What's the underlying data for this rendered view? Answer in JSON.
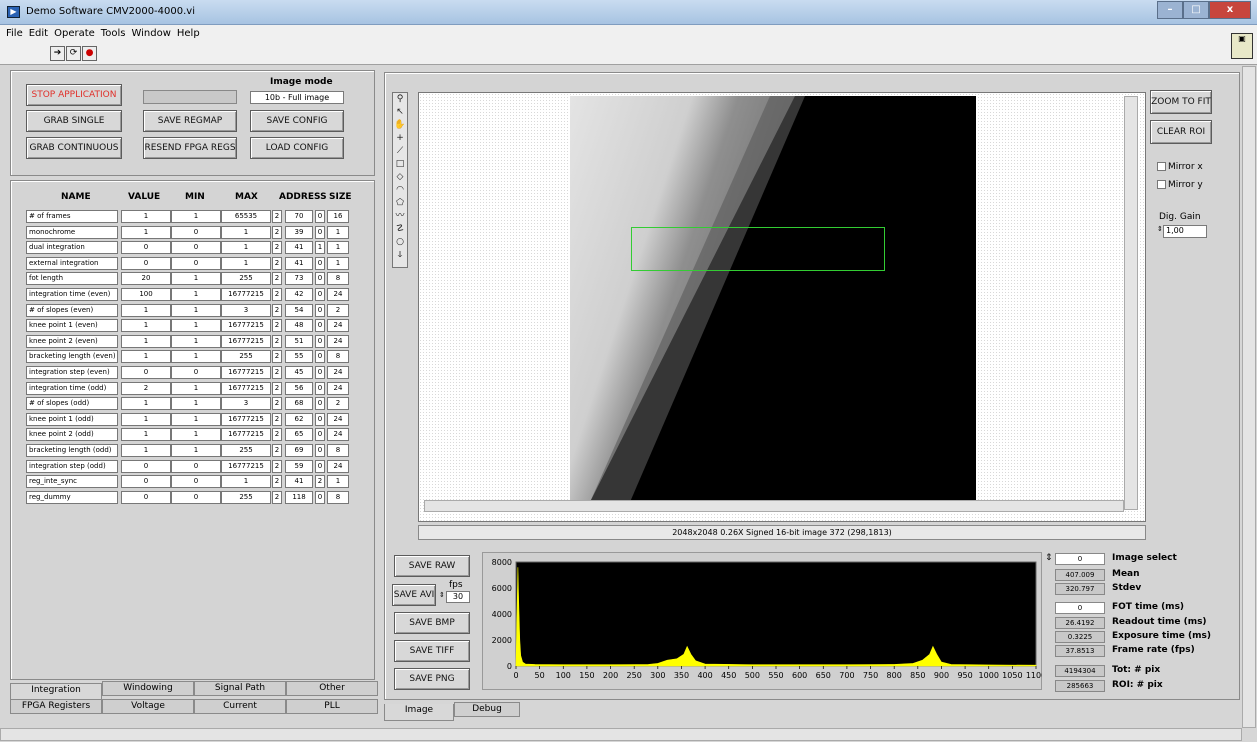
{
  "window": {
    "title": "Demo Software CMV2000-4000.vi",
    "icon": "labview-vi-icon"
  },
  "menu": [
    "File",
    "Edit",
    "Operate",
    "Tools",
    "Window",
    "Help"
  ],
  "controls": {
    "stop": "STOP APPLICATION",
    "grab_single": "GRAB SINGLE",
    "grab_continuous": "GRAB CONTINUOUS",
    "save_regmap": "SAVE REGMAP",
    "resend": "RESEND FPGA REGS",
    "save_config": "SAVE CONFIG",
    "load_config": "LOAD CONFIG",
    "image_mode_label": "Image mode",
    "image_mode_value": "10b - Full image"
  },
  "table": {
    "headers": [
      "NAME",
      "VALUE",
      "MIN",
      "MAX",
      "ADDRESS",
      "SIZE"
    ],
    "rows": [
      [
        "# of frames",
        "1",
        "1",
        "65535",
        "2",
        "70",
        "0",
        "16"
      ],
      [
        "monochrome",
        "1",
        "0",
        "1",
        "2",
        "39",
        "0",
        "1"
      ],
      [
        "dual integration",
        "0",
        "0",
        "1",
        "2",
        "41",
        "1",
        "1"
      ],
      [
        "external integration",
        "0",
        "0",
        "1",
        "2",
        "41",
        "0",
        "1"
      ],
      [
        "fot length",
        "20",
        "1",
        "255",
        "2",
        "73",
        "0",
        "8"
      ],
      [
        "integration time (even)",
        "100",
        "1",
        "16777215",
        "2",
        "42",
        "0",
        "24"
      ],
      [
        "# of slopes (even)",
        "1",
        "1",
        "3",
        "2",
        "54",
        "0",
        "2"
      ],
      [
        "knee point 1 (even)",
        "1",
        "1",
        "16777215",
        "2",
        "48",
        "0",
        "24"
      ],
      [
        "knee point 2 (even)",
        "1",
        "1",
        "16777215",
        "2",
        "51",
        "0",
        "24"
      ],
      [
        "bracketing length (even)",
        "1",
        "1",
        "255",
        "2",
        "55",
        "0",
        "8"
      ],
      [
        "integration step (even)",
        "0",
        "0",
        "16777215",
        "2",
        "45",
        "0",
        "24"
      ],
      [
        "integration time (odd)",
        "2",
        "1",
        "16777215",
        "2",
        "56",
        "0",
        "24"
      ],
      [
        "# of slopes (odd)",
        "1",
        "1",
        "3",
        "2",
        "68",
        "0",
        "2"
      ],
      [
        "knee point 1 (odd)",
        "1",
        "1",
        "16777215",
        "2",
        "62",
        "0",
        "24"
      ],
      [
        "knee point 2 (odd)",
        "1",
        "1",
        "16777215",
        "2",
        "65",
        "0",
        "24"
      ],
      [
        "bracketing length (odd)",
        "1",
        "1",
        "255",
        "2",
        "69",
        "0",
        "8"
      ],
      [
        "integration step (odd)",
        "0",
        "0",
        "16777215",
        "2",
        "59",
        "0",
        "24"
      ],
      [
        "reg_inte_sync",
        "0",
        "0",
        "1",
        "2",
        "41",
        "2",
        "1"
      ],
      [
        "reg_dummy",
        "0",
        "0",
        "255",
        "2",
        "118",
        "0",
        "8"
      ]
    ]
  },
  "left_tabs_top": [
    "Integration",
    "Windowing",
    "Signal Path",
    "Other"
  ],
  "left_tabs_bottom": [
    "FPGA Registers",
    "Voltage",
    "Current",
    "PLL"
  ],
  "image": {
    "status": "2048x2048 0.26X Signed 16-bit image 372    (298,1813)",
    "zoom_to_fit": "ZOOM TO FIT",
    "clear_roi": "CLEAR ROI",
    "mirror_x": "Mirror x",
    "mirror_y": "Mirror y",
    "dig_gain_label": "Dig. Gain",
    "dig_gain_value": "1,00"
  },
  "save": {
    "raw": "SAVE RAW",
    "avi": "SAVE AVI",
    "fps_label": "fps",
    "fps_value": "30",
    "bmp": "SAVE BMP",
    "tiff": "SAVE TIFF",
    "png": "SAVE PNG"
  },
  "bottom_tabs": [
    "Image",
    "Debug"
  ],
  "stats": [
    {
      "value": "0",
      "label": "Image select"
    },
    {
      "value": "407.009",
      "label": "Mean"
    },
    {
      "value": "320.797",
      "label": "Stdev"
    },
    {
      "value": "0",
      "label": "FOT time (ms)"
    },
    {
      "value": "26.4192",
      "label": "Readout time (ms)"
    },
    {
      "value": "0.3225",
      "label": "Exposure time (ms)"
    },
    {
      "value": "37.8513",
      "label": "Frame rate (fps)"
    },
    {
      "value": "4194304",
      "label": "Tot: # pix"
    },
    {
      "value": "285663",
      "label": "ROI: # pix"
    }
  ],
  "chart_data": {
    "type": "area",
    "title": "",
    "xlabel": "",
    "ylabel": "",
    "xlim": [
      0,
      1100
    ],
    "ylim": [
      0,
      8000
    ],
    "xticks": [
      "0",
      "50",
      "100",
      "150",
      "200",
      "250",
      "300",
      "350",
      "400",
      "450",
      "500",
      "550",
      "600",
      "650",
      "700",
      "750",
      "800",
      "850",
      "900",
      "950",
      "1000",
      "1050",
      "1100"
    ],
    "yticks": [
      "0",
      "2000",
      "4000",
      "6000",
      "8000"
    ],
    "series": [
      {
        "color": "#ffff00",
        "x": [
          0,
          4,
          6,
          8,
          10,
          14,
          20,
          40,
          100,
          200,
          280,
          300,
          320,
          340,
          355,
          362,
          370,
          380,
          400,
          500,
          600,
          700,
          800,
          840,
          860,
          875,
          882,
          890,
          900,
          920,
          1000,
          1100
        ],
        "y": [
          0,
          7600,
          4500,
          2000,
          800,
          300,
          150,
          120,
          100,
          100,
          120,
          200,
          450,
          550,
          900,
          1500,
          900,
          400,
          150,
          100,
          100,
          100,
          120,
          200,
          450,
          900,
          1500,
          900,
          300,
          120,
          80,
          60
        ]
      }
    ]
  }
}
